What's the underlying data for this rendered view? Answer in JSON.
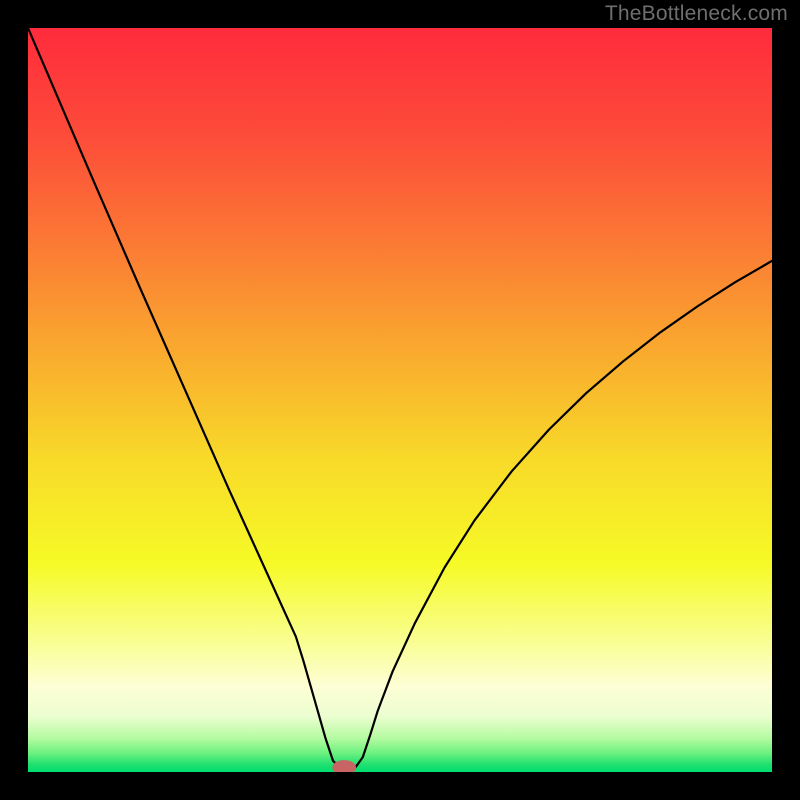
{
  "watermark": "TheBottleneck.com",
  "chart_data": {
    "type": "line",
    "title": "",
    "xlabel": "",
    "ylabel": "",
    "xlim": [
      0,
      100
    ],
    "ylim": [
      0,
      100
    ],
    "background_gradient": {
      "stops": [
        {
          "offset": 0.0,
          "color": "#fe2b3c"
        },
        {
          "offset": 0.15,
          "color": "#fd4d39"
        },
        {
          "offset": 0.3,
          "color": "#fb7d34"
        },
        {
          "offset": 0.45,
          "color": "#f9af2e"
        },
        {
          "offset": 0.58,
          "color": "#f8da29"
        },
        {
          "offset": 0.72,
          "color": "#f6fa26"
        },
        {
          "offset": 0.82,
          "color": "#f9fe8d"
        },
        {
          "offset": 0.885,
          "color": "#fdfed5"
        },
        {
          "offset": 0.925,
          "color": "#ecfed0"
        },
        {
          "offset": 0.955,
          "color": "#b3fba0"
        },
        {
          "offset": 0.975,
          "color": "#6bf17f"
        },
        {
          "offset": 0.99,
          "color": "#1fe070"
        },
        {
          "offset": 1.0,
          "color": "#00dd6e"
        }
      ]
    },
    "series": [
      {
        "name": "bottleneck-curve",
        "x": [
          0,
          3,
          6,
          9,
          12,
          15,
          18,
          21,
          24,
          27,
          30,
          33,
          36,
          37,
          38,
          39,
          40,
          41,
          42,
          43,
          44,
          45,
          46,
          47,
          49,
          52,
          56,
          60,
          65,
          70,
          75,
          80,
          85,
          90,
          95,
          100
        ],
        "y": [
          100,
          93.0,
          86.0,
          79.0,
          72.1,
          65.2,
          58.4,
          51.6,
          44.8,
          38.0,
          31.4,
          24.8,
          18.2,
          15.0,
          11.5,
          8.0,
          4.5,
          1.5,
          0.5,
          0.2,
          0.6,
          2.0,
          5.0,
          8.2,
          13.5,
          20.0,
          27.5,
          33.8,
          40.4,
          46.0,
          50.9,
          55.2,
          59.1,
          62.6,
          65.8,
          68.7
        ]
      }
    ],
    "marker": {
      "x": 42.5,
      "y": 0.6,
      "rx": 1.6,
      "ry": 1.0,
      "color": "#c86464"
    }
  }
}
